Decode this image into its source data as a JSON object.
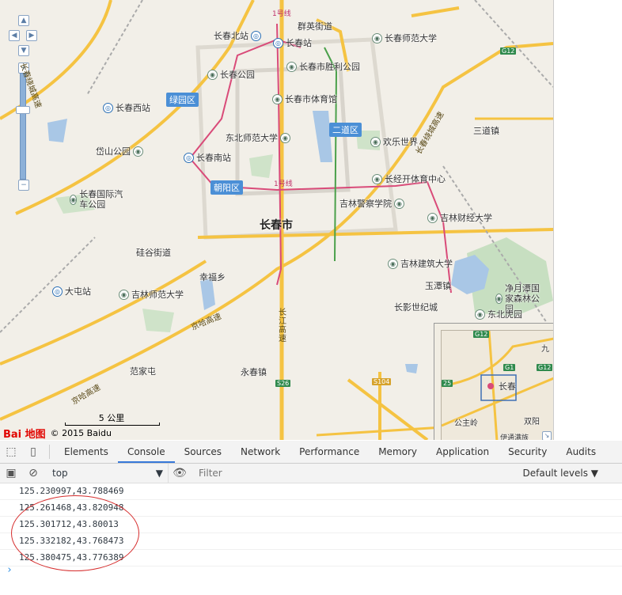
{
  "map": {
    "city_label": "长春市",
    "districts": [
      "绿园区",
      "二道区",
      "朝阳区"
    ],
    "pois": [
      {
        "name": "长春北站",
        "type": "station"
      },
      {
        "name": "长春站",
        "type": "station"
      },
      {
        "name": "群英街道",
        "type": "text"
      },
      {
        "name": "长春师范大学",
        "type": "poi"
      },
      {
        "name": "长春市胜利公园",
        "type": "poi"
      },
      {
        "name": "长春公园",
        "type": "poi"
      },
      {
        "name": "长春市体育馆",
        "type": "poi"
      },
      {
        "name": "长春西站",
        "type": "station"
      },
      {
        "name": "东北师范大学",
        "type": "text"
      },
      {
        "name": "欢乐世界",
        "type": "poi"
      },
      {
        "name": "三道镇",
        "type": "text"
      },
      {
        "name": "岱山公园",
        "type": "poi"
      },
      {
        "name": "长春南站",
        "type": "station"
      },
      {
        "name": "长经开体育中心",
        "type": "poi"
      },
      {
        "name": "长春国际汽车公园",
        "type": "poi"
      },
      {
        "name": "吉林警察学院",
        "type": "poi"
      },
      {
        "name": "吉林财经大学",
        "type": "poi"
      },
      {
        "name": "硅谷街道",
        "type": "text"
      },
      {
        "name": "吉林建筑大学",
        "type": "poi"
      },
      {
        "name": "大屯站",
        "type": "station"
      },
      {
        "name": "幸福乡",
        "type": "text"
      },
      {
        "name": "吉林师范大学",
        "type": "poi"
      },
      {
        "name": "玉潭镇",
        "type": "text"
      },
      {
        "name": "净月潭国家森林公园",
        "type": "poi"
      },
      {
        "name": "长影世纪城",
        "type": "text"
      },
      {
        "name": "东北虎园",
        "type": "poi"
      },
      {
        "name": "范家屯",
        "type": "text"
      },
      {
        "name": "永春镇",
        "type": "text"
      }
    ],
    "highways": [
      "京哈高速",
      "京哈高速",
      "长江高速",
      "长春绕城高速",
      "长春绕城高速"
    ],
    "shields": [
      "G12",
      "S26",
      "S104"
    ],
    "metro_lines": [
      "1号线",
      "1号线"
    ],
    "scale_label": "5 公里",
    "logo_text": "Bai 地图",
    "copyright": "© 2015 Baidu",
    "overview": {
      "shields": [
        "G12",
        "G1",
        "G12",
        "25"
      ],
      "places": [
        "长春",
        "公主岭",
        "双阳",
        "九"
      ],
      "extra": "伊通满族"
    }
  },
  "devtools": {
    "tabs": [
      "Elements",
      "Console",
      "Sources",
      "Network",
      "Performance",
      "Memory",
      "Application",
      "Security",
      "Audits"
    ],
    "active_tab": "Console",
    "context": "top",
    "filter_placeholder": "Filter",
    "levels": "Default levels ▼",
    "console_lines": [
      "125.230997,43.788469",
      "125.261468,43.820948",
      "125.301712,43.80013",
      "125.332182,43.768473",
      "125.380475,43.776389"
    ]
  }
}
